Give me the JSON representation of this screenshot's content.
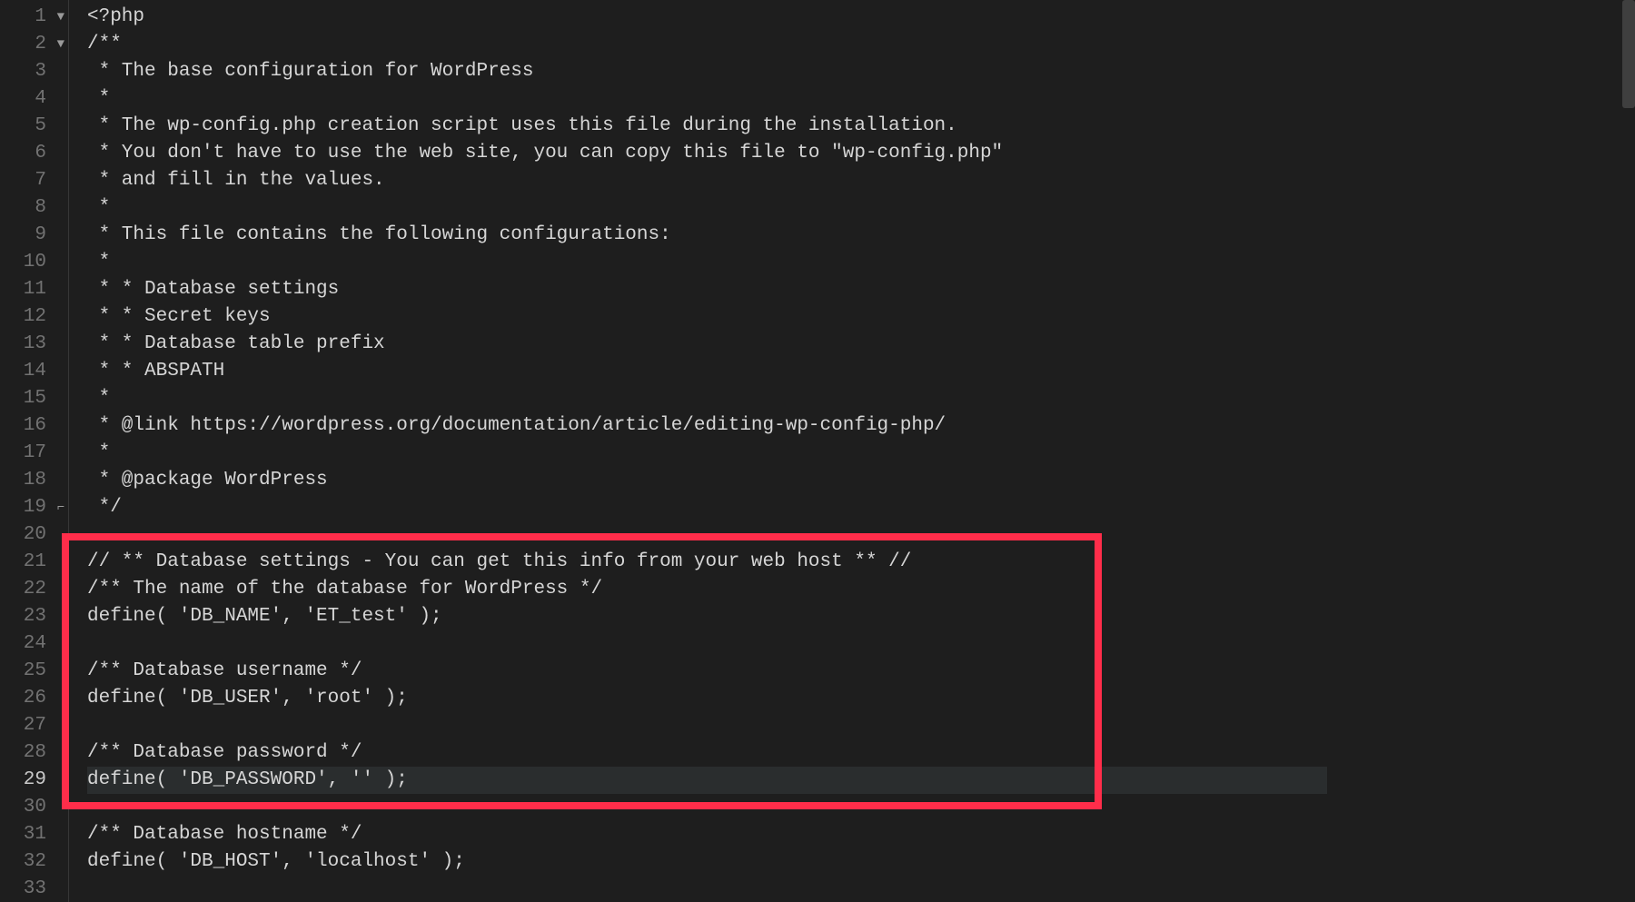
{
  "editor": {
    "first_line": 1,
    "last_line": 33,
    "active_line": 29,
    "highlight_box": {
      "from_line": 21,
      "to_line": 30
    },
    "fold_markers": {
      "1": "▼",
      "2": "▼",
      "19": "⌐"
    },
    "lines": [
      "<?php",
      "/**",
      " * The base configuration for WordPress",
      " *",
      " * The wp-config.php creation script uses this file during the installation.",
      " * You don't have to use the web site, you can copy this file to \"wp-config.php\"",
      " * and fill in the values.",
      " *",
      " * This file contains the following configurations:",
      " *",
      " * * Database settings",
      " * * Secret keys",
      " * * Database table prefix",
      " * * ABSPATH",
      " *",
      " * @link https://wordpress.org/documentation/article/editing-wp-config-php/",
      " *",
      " * @package WordPress",
      " */",
      "",
      "// ** Database settings - You can get this info from your web host ** //",
      "/** The name of the database for WordPress */",
      "define( 'DB_NAME', 'ET_test' );",
      "",
      "/** Database username */",
      "define( 'DB_USER', 'root' );",
      "",
      "/** Database password */",
      "define( 'DB_PASSWORD', '' );",
      "",
      "/** Database hostname */",
      "define( 'DB_HOST', 'localhost' );",
      ""
    ]
  },
  "scrollbar": {
    "thumb_top_pct": 0,
    "thumb_height_pct": 12
  }
}
